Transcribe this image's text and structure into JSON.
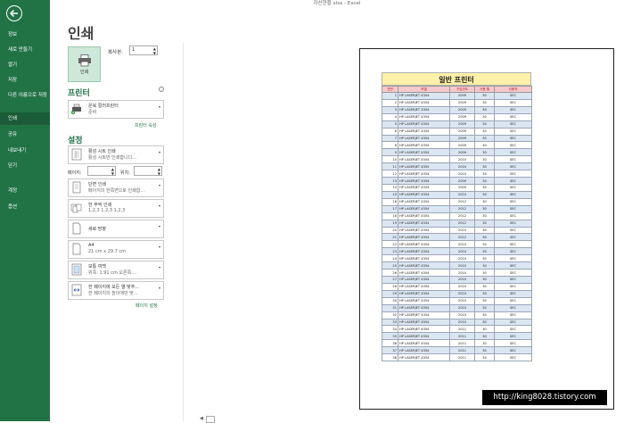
{
  "window": {
    "title": "자산현황.xlsx - Excel"
  },
  "sidebar": {
    "items": [
      {
        "label": "정보"
      },
      {
        "label": "새로 만들기"
      },
      {
        "label": "열기"
      },
      {
        "label": "저장"
      },
      {
        "label": "다른 이름으로 저장"
      },
      {
        "label": "인쇄"
      },
      {
        "label": "공유"
      },
      {
        "label": "내보내기"
      },
      {
        "label": "닫기"
      },
      {
        "label": "계정"
      },
      {
        "label": "옵션"
      }
    ],
    "active_index": 5
  },
  "print": {
    "title": "인쇄",
    "button_label": "인쇄",
    "copies_label": "복사본:",
    "copies_value": "1"
  },
  "printer": {
    "section_title": "프린터",
    "name": "온북 컬러프린터",
    "status": "준비",
    "properties_link": "프린터 속성"
  },
  "settings": {
    "section_title": "설정",
    "scope": {
      "line1": "활성 시트 인쇄",
      "line2": "활성 시트만 인쇄합니다..."
    },
    "pages_label": "페이지:",
    "pages_from": "",
    "to_label": "위치:",
    "pages_to": "",
    "sides": {
      "line1": "단면 인쇄",
      "line2": "페이지의 한쪽면으로 인쇄합..."
    },
    "collate": {
      "line1": "한 부씩 인쇄",
      "line2": "1,2,3    1,2,3    1,2,3"
    },
    "orientation": {
      "line1": "세로 방향",
      "line2": ""
    },
    "paper": {
      "line1": "A4",
      "line2": "21 cm x 29.7 cm"
    },
    "margins": {
      "line1": "보통 여백",
      "line2": "위쪽:  1.91 cm   오른쪽:..."
    },
    "scaling": {
      "line1": "한 페이지에 모든 열 맞추...",
      "line2": "한 페이지의 높이에만 맞..."
    },
    "page_setup_link": "페이지 설정"
  },
  "preview": {
    "sheet_title": "일반 프린터",
    "columns": [
      "연번",
      "모델",
      "구입연도",
      "사용 월",
      "사용처"
    ],
    "rows": [
      [
        "1",
        "HP LASERJET 4354",
        "2009",
        "30",
        "SEC"
      ],
      [
        "2",
        "HP LASERJET 4354",
        "2009",
        "30",
        "SEC"
      ],
      [
        "3",
        "HP LASERJET 4354",
        "2009",
        "30",
        "SEC"
      ],
      [
        "4",
        "HP LASERJET 4354",
        "2009",
        "30",
        "SEC"
      ],
      [
        "5",
        "HP LASERJET 4354",
        "2009",
        "30",
        "SEC"
      ],
      [
        "6",
        "HP LASERJET 4354",
        "2009",
        "30",
        "SEC"
      ],
      [
        "7",
        "HP LASERJET 4354",
        "2009",
        "30",
        "SEC"
      ],
      [
        "8",
        "HP LASERJET 4354",
        "2009",
        "30",
        "SEC"
      ],
      [
        "9",
        "HP LASERJET 4354",
        "2009",
        "30",
        "SEC"
      ],
      [
        "10",
        "HP LASERJET 4354",
        "2010",
        "30",
        "SEC"
      ],
      [
        "11",
        "HP LASERJET 4354",
        "2010",
        "30",
        "SEC"
      ],
      [
        "12",
        "HP LASERJET 4354",
        "2010",
        "30",
        "SEC"
      ],
      [
        "13",
        "HP LASERJET 4354",
        "2009",
        "30",
        "SEC"
      ],
      [
        "14",
        "HP LASERJET 4354",
        "2009",
        "30",
        "SEC"
      ],
      [
        "15",
        "HP LASERJET 4354",
        "2010",
        "30",
        "SEC"
      ],
      [
        "16",
        "HP LASERJET 4354",
        "2012",
        "30",
        "SEC"
      ],
      [
        "17",
        "HP LASERJET 4354",
        "2012",
        "30",
        "SEC"
      ],
      [
        "18",
        "HP LASERJET 4354",
        "2012",
        "30",
        "SEC"
      ],
      [
        "19",
        "HP LASERJET 4354",
        "2012",
        "30",
        "SEC"
      ],
      [
        "20",
        "HP LASERJET 4354",
        "2010",
        "30",
        "SEC"
      ],
      [
        "21",
        "HP LASERJET 4354",
        "2012",
        "30",
        "SEC"
      ],
      [
        "22",
        "HP LASERJET 4354",
        "2010",
        "30",
        "SEC"
      ],
      [
        "23",
        "HP LASERJET 4354",
        "2010",
        "30",
        "SEC"
      ],
      [
        "24",
        "HP LASERJET 4354",
        "2010",
        "30",
        "SEC"
      ],
      [
        "25",
        "HP LASERJET 4354",
        "2010",
        "30",
        "SEC"
      ],
      [
        "26",
        "HP LASERJET 4354",
        "2010",
        "30",
        "SEC"
      ],
      [
        "27",
        "HP LASERJET 4354",
        "2010",
        "30",
        "SEC"
      ],
      [
        "28",
        "HP LASERJET 4354",
        "2010",
        "30",
        "SEC"
      ],
      [
        "29",
        "HP LASERJET 4354",
        "2010",
        "30",
        "SEC"
      ],
      [
        "30",
        "HP LASERJET 4354",
        "2010",
        "30",
        "SEC"
      ],
      [
        "31",
        "HP LASERJET 4354",
        "2010",
        "30",
        "SEC"
      ],
      [
        "32",
        "HP LASERJET 4354",
        "2010",
        "30",
        "SEC"
      ],
      [
        "33",
        "HP LASERJET 4354",
        "2010",
        "30",
        "SEC"
      ],
      [
        "34",
        "HP LASERJET 4354",
        "2011",
        "30",
        "SEC"
      ],
      [
        "35",
        "HP LASERJET 4354",
        "2011",
        "30",
        "SEC"
      ],
      [
        "36",
        "HP LASERJET 4354",
        "2011",
        "30",
        "SEC"
      ],
      [
        "37",
        "HP LASERJET 4354",
        "2011",
        "30",
        "SEC"
      ],
      [
        "38",
        "HP LASERJET 4354",
        "2011",
        "30",
        "SEC"
      ]
    ]
  },
  "pager": {
    "current": "1"
  },
  "watermark": {
    "text": "http://king8028.tistory.com"
  },
  "colors": {
    "excel_green": "#217346",
    "title_fill": "#fff2a8",
    "header_fill": "#f6c9cc",
    "band_fill": "#dce6f2"
  }
}
